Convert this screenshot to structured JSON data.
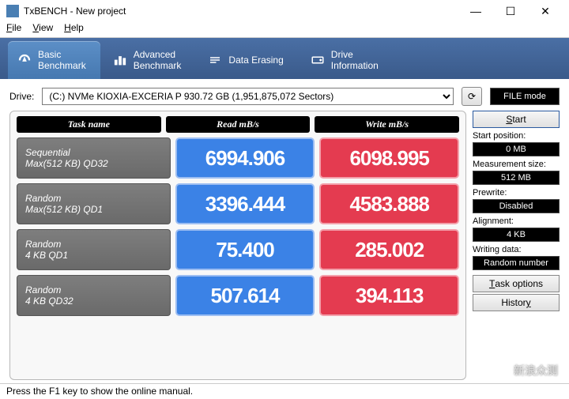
{
  "window": {
    "title": "TxBENCH - New project",
    "minimize": "—",
    "maximize": "☐",
    "close": "✕"
  },
  "menu": {
    "file": "File",
    "view": "View",
    "help": "Help"
  },
  "tabs": {
    "basic": "Basic\nBenchmark",
    "advanced": "Advanced\nBenchmark",
    "erase": "Data Erasing",
    "drive": "Drive\nInformation"
  },
  "drive": {
    "label": "Drive:",
    "selected": "(C:) NVMe KIOXIA-EXCERIA P  930.72 GB (1,951,875,072 Sectors)",
    "filemode": "FILE mode"
  },
  "headers": {
    "task": "Task name",
    "read": "Read mB/s",
    "write": "Write mB/s"
  },
  "rows": [
    {
      "task_l1": "Sequential",
      "task_l2": "Max(512 KB) QD32",
      "read": "6994.906",
      "write": "6098.995"
    },
    {
      "task_l1": "Random",
      "task_l2": "Max(512 KB) QD1",
      "read": "3396.444",
      "write": "4583.888"
    },
    {
      "task_l1": "Random",
      "task_l2": "4 KB QD1",
      "read": "75.400",
      "write": "285.002"
    },
    {
      "task_l1": "Random",
      "task_l2": "4 KB QD32",
      "read": "507.614",
      "write": "394.113"
    }
  ],
  "side": {
    "start": "Start",
    "startpos_lbl": "Start position:",
    "startpos_val": "0 MB",
    "meas_lbl": "Measurement size:",
    "meas_val": "512 MB",
    "prew_lbl": "Prewrite:",
    "prew_val": "Disabled",
    "align_lbl": "Alignment:",
    "align_val": "4 KB",
    "wd_lbl": "Writing data:",
    "wd_val": "Random number",
    "taskopt": "Task options",
    "history": "History"
  },
  "status": "Press the F1 key to show the online manual.",
  "watermark": "新浪众测"
}
